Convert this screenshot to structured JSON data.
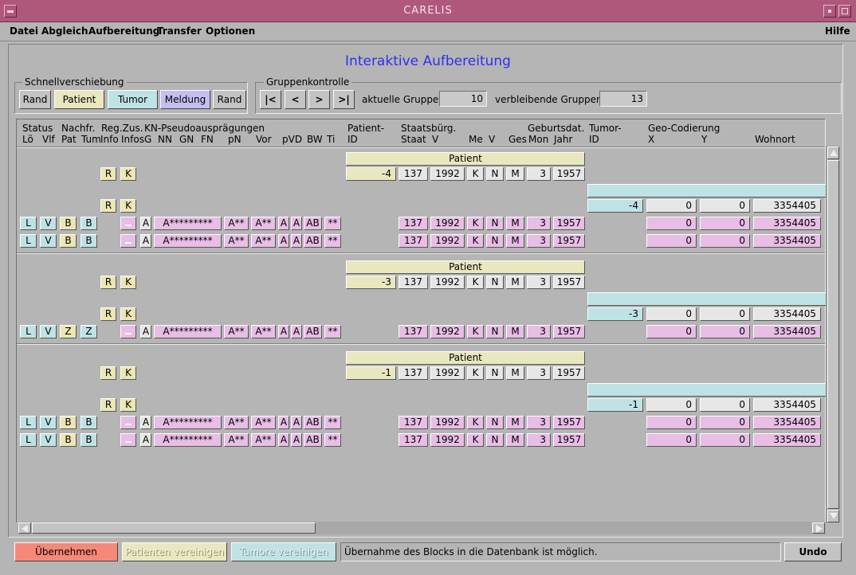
{
  "window": {
    "title": "CARELIS"
  },
  "menu": {
    "items": [
      "Datei",
      "Abgleich",
      "Aufbereitung",
      "Transfer",
      "Optionen"
    ],
    "help": "Hilfe"
  },
  "heading": "Interaktive Aufbereitung",
  "schnell": {
    "legend": "Schnellverschiebung",
    "buttons": [
      "Rand",
      "Patient",
      "Tumor",
      "Meldung",
      "Rand"
    ]
  },
  "gruppen": {
    "legend": "Gruppenkontrolle",
    "nav": [
      "|<",
      "<",
      ">",
      ">|"
    ],
    "aktuelle_label": "aktuelle Gruppe:",
    "aktuelle_value": "10",
    "verbleibende_label": "verbleibende Gruppen:",
    "verbleibende_value": "13"
  },
  "headers": {
    "status": "Status",
    "lo": "Lö",
    "vlf": "Vlf",
    "nachfr": "Nachfr.",
    "pat": "Pat",
    "tum": "Tum",
    "regzus": "Reg.Zus.",
    "info": "Info",
    "infos": "Infos",
    "kn": "KN-Pseudoausprägungen",
    "g": "G",
    "nn": "NN",
    "gn": "GN",
    "fn": "FN",
    "pn": "pN",
    "vor": "Vor",
    "pvd": "pVD",
    "bw": "BW",
    "ti": "Ti",
    "patient": "Patient-",
    "patid": "ID",
    "staatsburg": "Staatsbürg.",
    "staat": "Staat",
    "v": "V",
    "me": "Me",
    "v2": "V",
    "ges": "Ges",
    "geburtsdat": "Geburtsdat.",
    "mon": "Mon",
    "jahr": "Jahr",
    "tumor": "Tumor-",
    "tumid": "ID",
    "geo": "Geo-Codierung",
    "x": "X",
    "y": "Y",
    "wohnort": "Wohnort"
  },
  "labels": {
    "patient_banner": "Patient",
    "r": "R",
    "k": "K"
  },
  "groups": [
    {
      "patient": {
        "id": "-4",
        "staat": "137",
        "v": "1992",
        "me": "K",
        "v2": "N",
        "ges": "M",
        "mon": "3",
        "jahr": "1957"
      },
      "tumor": {
        "id": "-4",
        "x": "0",
        "y": "0",
        "wohnort": "3354405"
      },
      "records": [
        {
          "lo": "L",
          "vlf": "V",
          "pat": "B",
          "tum": "B",
          "g": "A",
          "nn": "A*********",
          "pn": "A**",
          "vor": "A**",
          "pvd1": "A",
          "pvd2": "A",
          "bw": "AB",
          "ti": "**",
          "staat": "137",
          "v": "1992",
          "me": "K",
          "v2": "N",
          "ges": "M",
          "mon": "3",
          "jahr": "1957",
          "x": "0",
          "y": "0",
          "wohnort": "3354405"
        },
        {
          "lo": "L",
          "vlf": "V",
          "pat": "B",
          "tum": "B",
          "g": "A",
          "nn": "A*********",
          "pn": "A**",
          "vor": "A**",
          "pvd1": "A",
          "pvd2": "A",
          "bw": "AB",
          "ti": "**",
          "staat": "137",
          "v": "1992",
          "me": "K",
          "v2": "N",
          "ges": "M",
          "mon": "3",
          "jahr": "1957",
          "x": "0",
          "y": "0",
          "wohnort": "3354405"
        }
      ]
    },
    {
      "patient": {
        "id": "-3",
        "staat": "137",
        "v": "1992",
        "me": "K",
        "v2": "N",
        "ges": "M",
        "mon": "3",
        "jahr": "1957"
      },
      "tumor": {
        "id": "-3",
        "x": "0",
        "y": "0",
        "wohnort": "3354405"
      },
      "records": [
        {
          "lo": "L",
          "vlf": "V",
          "pat": "Z",
          "tum": "Z",
          "g": "A",
          "nn": "A*********",
          "pn": "A**",
          "vor": "A**",
          "pvd1": "A",
          "pvd2": "A",
          "bw": "AB",
          "ti": "**",
          "staat": "137",
          "v": "1992",
          "me": "K",
          "v2": "N",
          "ges": "M",
          "mon": "3",
          "jahr": "1957",
          "x": "0",
          "y": "0",
          "wohnort": "3354405"
        }
      ]
    },
    {
      "patient": {
        "id": "-1",
        "staat": "137",
        "v": "1992",
        "me": "K",
        "v2": "N",
        "ges": "M",
        "mon": "3",
        "jahr": "1957"
      },
      "tumor": {
        "id": "-1",
        "x": "0",
        "y": "0",
        "wohnort": "3354405"
      },
      "records": [
        {
          "lo": "L",
          "vlf": "V",
          "pat": "B",
          "tum": "B",
          "g": "A",
          "nn": "A*********",
          "pn": "A**",
          "vor": "A**",
          "pvd1": "A",
          "pvd2": "A",
          "bw": "AB",
          "ti": "**",
          "staat": "137",
          "v": "1992",
          "me": "K",
          "v2": "N",
          "ges": "M",
          "mon": "3",
          "jahr": "1957",
          "x": "0",
          "y": "0",
          "wohnort": "3354405"
        },
        {
          "lo": "L",
          "vlf": "V",
          "pat": "B",
          "tum": "B",
          "g": "A",
          "nn": "A*********",
          "pn": "A**",
          "vor": "A**",
          "pvd1": "A",
          "pvd2": "A",
          "bw": "AB",
          "ti": "**",
          "staat": "137",
          "v": "1992",
          "me": "K",
          "v2": "N",
          "ges": "M",
          "mon": "3",
          "jahr": "1957",
          "x": "0",
          "y": "0",
          "wohnort": "3354405"
        }
      ]
    }
  ],
  "bottom": {
    "ubernehmen": "Übernehmen",
    "pat_verein": "Patienten vereinigen",
    "tum_verein": "Tumore vereinigen",
    "status": "Übernahme des Blocks in die Datenbank ist möglich.",
    "undo": "Undo"
  },
  "colors": {
    "patient": "#e9e7bf",
    "tumor": "#bfe3e4",
    "meldung": "#e8bde6",
    "info": "#ebe6b4",
    "ubernehmen": "#f58878",
    "title": "#b0587c",
    "heading": "#2f2ff0",
    "grey_cell": "#e6e6e6"
  }
}
